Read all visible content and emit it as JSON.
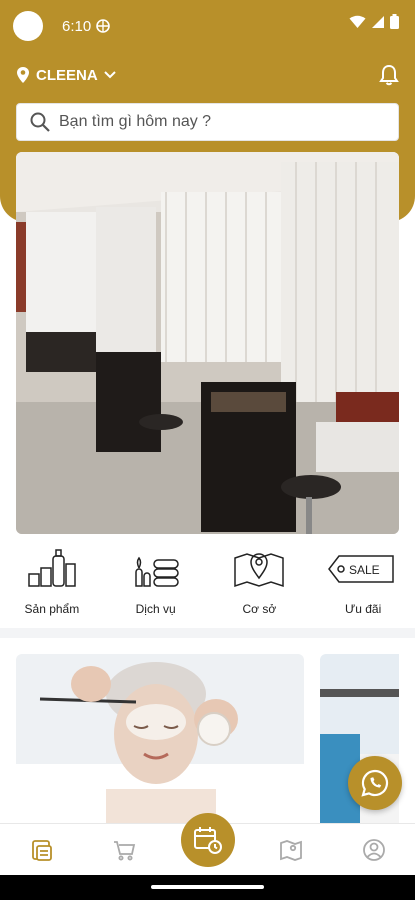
{
  "status_bar": {
    "time": "6:10"
  },
  "header": {
    "location": "CLEENA"
  },
  "search": {
    "placeholder": "Bạn tìm gì hôm nay ?"
  },
  "categories": [
    {
      "label": "Sản phẩm",
      "icon": "cosmetics-icon"
    },
    {
      "label": "Dịch vụ",
      "icon": "spa-service-icon"
    },
    {
      "label": "Cơ sở",
      "icon": "map-pin-icon"
    },
    {
      "label": "Ưu đãi",
      "icon": "sale-tag-icon"
    }
  ],
  "sale_tag_text": "SALE",
  "colors": {
    "brand": "#b8902a",
    "divider": "#f3f4f6"
  },
  "bottom_nav": [
    "home-icon",
    "cart-icon",
    "booking-calendar-icon",
    "map-icon",
    "profile-icon"
  ]
}
